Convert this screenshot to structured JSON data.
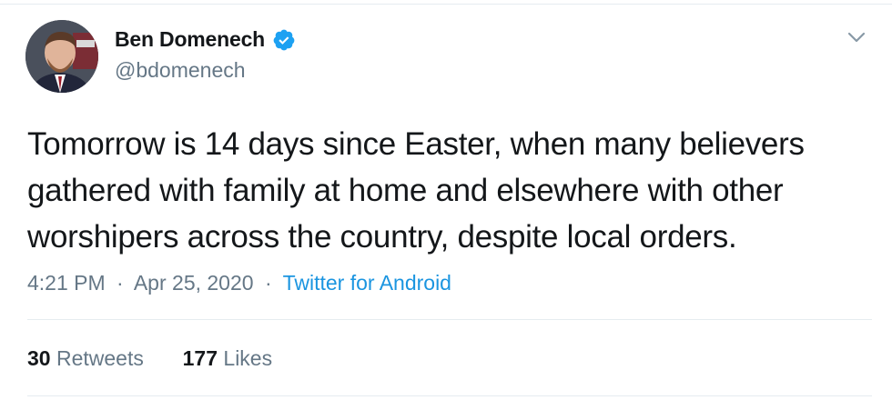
{
  "tweet": {
    "author": {
      "display_name": "Ben Domenech",
      "handle": "@bdomenech",
      "verified": true,
      "avatar_icon": "profile-photo"
    },
    "text": "Tomorrow is 14 days since Easter, when many believers\ngathered with family at home and elsewhere with other\nworshipers across the country, despite local orders.",
    "time": "4:21 PM",
    "separator": "·",
    "date": "Apr 25, 2020",
    "source": "Twitter for Android",
    "retweets_count": "30",
    "retweets_label": "Retweets",
    "likes_count": "177",
    "likes_label": "Likes"
  },
  "icons": {
    "verified": "verified-badge-icon",
    "menu": "chevron-down-icon"
  },
  "colors": {
    "text_primary": "#14171a",
    "text_secondary": "#657786",
    "link": "#1b95e0",
    "verified": "#1da1f2",
    "divider": "#e6ecf0"
  }
}
